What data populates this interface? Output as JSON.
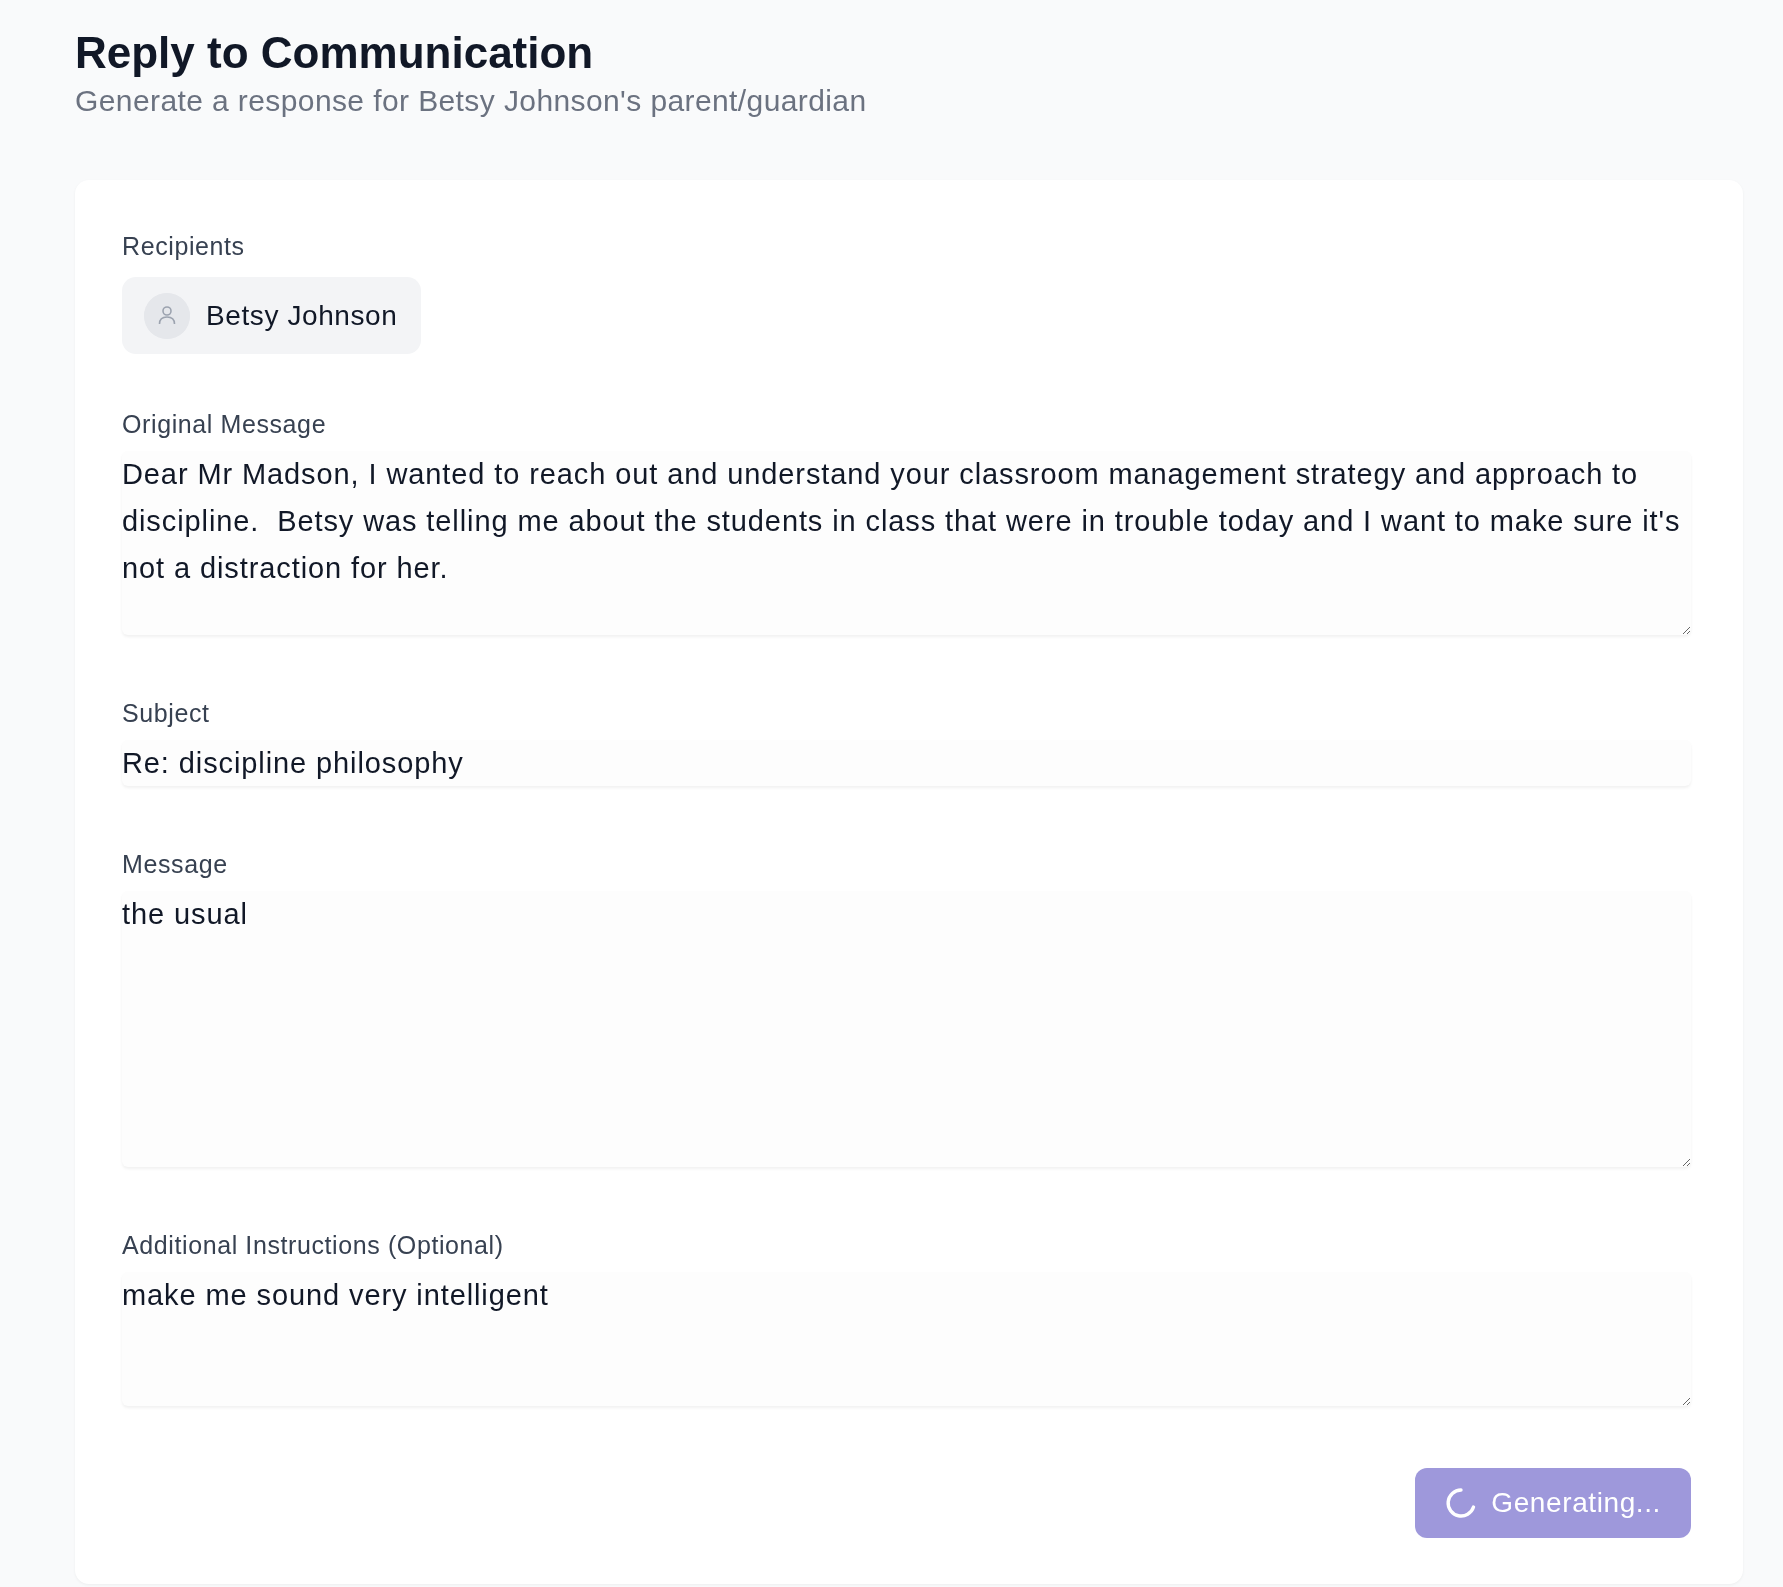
{
  "header": {
    "title": "Reply to Communication",
    "subtitle": "Generate a response for Betsy Johnson's parent/guardian"
  },
  "recipients": {
    "label": "Recipients",
    "items": [
      {
        "name": "Betsy Johnson"
      }
    ]
  },
  "fields": [
    {
      "kind": "textarea",
      "label": "Original Message",
      "value": "Dear Mr Madson, I wanted to reach out and understand your classroom management strategy and approach to discipline.  Betsy was telling me about the students in class that were in trouble today and I want to make sure it's not a distraction for her."
    },
    {
      "kind": "input",
      "label": "Subject",
      "value": "Re: discipline philosophy"
    },
    {
      "kind": "textarea",
      "label": "Message",
      "value": "the usual"
    },
    {
      "kind": "textarea",
      "label": "Additional Instructions (Optional)",
      "value": "make me sound very intelligent"
    }
  ],
  "generate_button": {
    "label": "Generating...",
    "loading": true
  }
}
